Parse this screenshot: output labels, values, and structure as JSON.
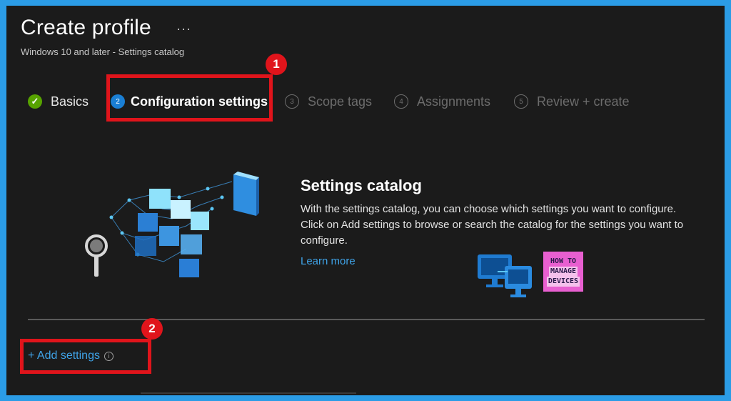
{
  "page": {
    "title": "Create profile",
    "more_label": "···",
    "subtitle": "Windows 10 and later - Settings catalog"
  },
  "steps": [
    {
      "num": "✓",
      "label": "Basics",
      "state": "done"
    },
    {
      "num": "2",
      "label": "Configuration settings",
      "state": "active"
    },
    {
      "num": "3",
      "label": "Scope tags",
      "state": "pending"
    },
    {
      "num": "4",
      "label": "Assignments",
      "state": "pending"
    },
    {
      "num": "5",
      "label": "Review + create",
      "state": "pending"
    }
  ],
  "annotations": [
    {
      "label": "1"
    },
    {
      "label": "2"
    }
  ],
  "catalog": {
    "title": "Settings catalog",
    "description": "With the settings catalog, you can choose which settings you want to configure. Click on Add settings to browse or search the catalog for the settings you want to configure.",
    "learn_more": "Learn more"
  },
  "logo": {
    "lines": [
      "HOW TO",
      "MANAGE",
      "DEVICES"
    ]
  },
  "add_settings": {
    "label": "+ Add settings",
    "info_icon": "i"
  },
  "colors": {
    "background": "#1b1b1b",
    "frame": "#2b9ce6",
    "accent_link": "#3fa3e8",
    "highlight": "#e0141b",
    "success": "#57a300",
    "active_step": "#1a7fd4",
    "logo_bg": "#e85fd0"
  },
  "icons": [
    "more-icon",
    "checkmark-icon",
    "info-icon",
    "settings-catalog-illustration",
    "how-to-manage-devices-logo"
  ]
}
